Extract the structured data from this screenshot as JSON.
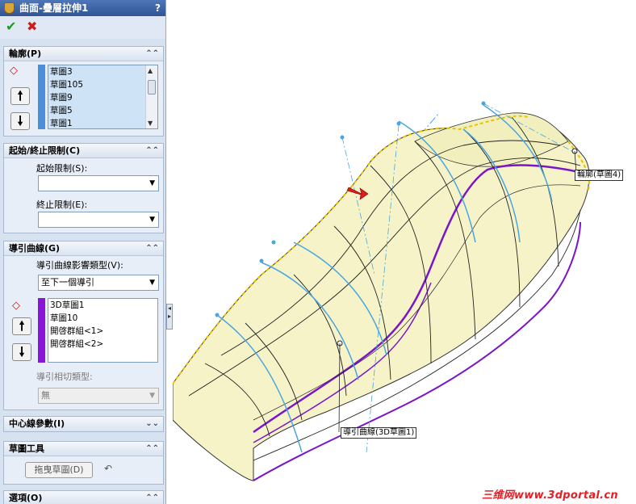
{
  "property_manager": {
    "title": "曲面-疊層拉伸1",
    "help": "?",
    "ok_icon": "check-icon",
    "cancel_icon": "x-icon",
    "profile_group": {
      "title": "輪廓(P)",
      "items": [
        "草圖3",
        "草圖105",
        "草圖9",
        "草圖5",
        "草圖1"
      ]
    },
    "start_end_group": {
      "title": "起始/終止限制(C)",
      "start_label": "起始限制(S):",
      "start_value": "",
      "end_label": "終止限制(E):",
      "end_value": ""
    },
    "guide_group": {
      "title": "導引曲線(G)",
      "influence_label": "導引曲線影響類型(V):",
      "influence_value": "至下一個導引",
      "items": [
        "3D草圖1",
        "草圖10",
        "開啓群組<1>",
        "開啓群組<2>"
      ],
      "tangency_label": "導引相切類型:",
      "tangency_value": "無"
    },
    "centerline_group": {
      "title": "中心線參數(I)"
    },
    "sketch_tools_group": {
      "title": "草圖工具",
      "drag_button": "拖曳草圖(D)"
    },
    "options_group": {
      "title": "選項(O)"
    }
  },
  "viewport": {
    "callout_profile": "輪廓(草圖4)",
    "callout_guide": "導引曲線(3D草圖1)",
    "watermark": "三维网www.3dportal.cn"
  },
  "colors": {
    "surface": "#f6f3c8",
    "guide_curve": "#7a16c8",
    "profile_curve": "#4aa6e0",
    "profile_strip": "#4a90d9",
    "guide_strip": "#8a14d8",
    "accent_title": "#3a64a8"
  }
}
